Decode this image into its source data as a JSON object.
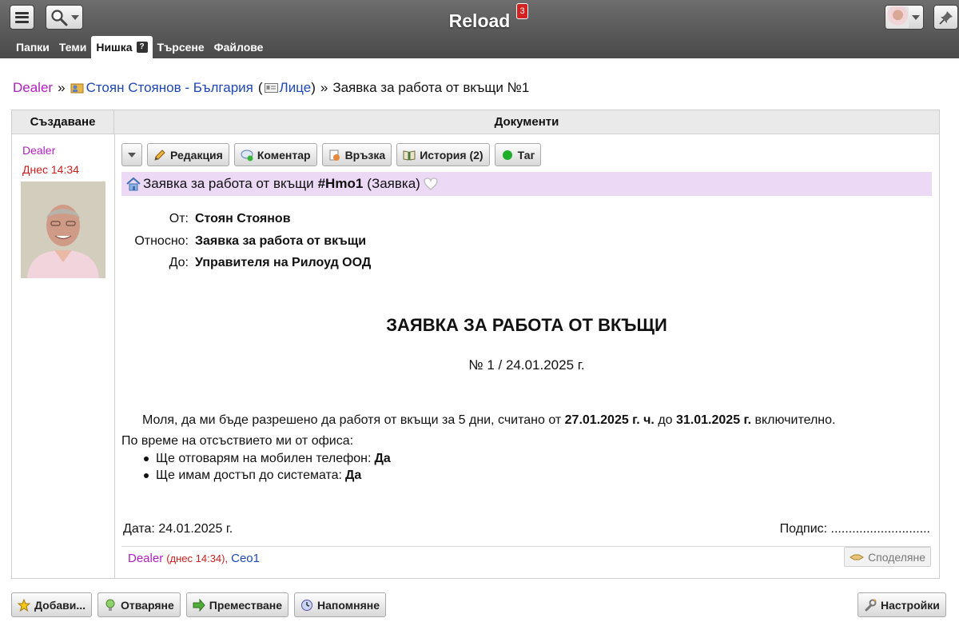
{
  "app": {
    "title": "Reload",
    "notifications": "3"
  },
  "tabs": [
    {
      "label": "Папки"
    },
    {
      "label": "Теми"
    },
    {
      "label": "Нишка",
      "help": "?"
    },
    {
      "label": "Търсене"
    },
    {
      "label": "Файлове"
    }
  ],
  "breadcrumb": {
    "root": "Dealer",
    "sep": "»",
    "contact": "Стоян Стоянов - България",
    "paren_open": "(",
    "type": "Лице",
    "paren_close": ")",
    "sep2": "»",
    "current": "Заявка за работа от вкъщи №1"
  },
  "columns": {
    "left": "Създаване",
    "right": "Документи"
  },
  "creator": {
    "name": "Dealer",
    "time": "Днес 14:34"
  },
  "toolbar": {
    "edit": "Редакция",
    "comment": "Коментар",
    "link": "Връзка",
    "history": "История (2)",
    "tag": "Таг"
  },
  "document": {
    "title_prefix": "Заявка за работа от вкъщи",
    "code": "#Hmo1",
    "kind": "(Заявка)",
    "from_label": "От:",
    "from": "Стоян Стоянов",
    "subject_label": "Относно:",
    "subject": "Заявка за работа от вкъщи",
    "to_label": "До:",
    "to": "Управителя на Рилоуд ООД",
    "heading": "ЗАЯВКА ЗА РАБОТА ОТ ВКЪЩИ",
    "number": "№ 1 / 24.01.2025 г.",
    "body_start": "Моля, да ми бъде разрешено да работя от вкъщи за 5 дни, считано от",
    "date_from": "27.01.2025 г. ч.",
    "body_mid": "до",
    "date_to": "31.01.2025 г.",
    "body_end": "включително.",
    "absence_intro": "По време на отсъствието ми от офиса:",
    "bullet1_text": "Ще отговарям на мобилен телефон:",
    "bullet1_val": "Да",
    "bullet2_text": "Ще имам достъп до системата:",
    "bullet2_val": "Да",
    "date_line": "Дата: 24.01.2025 г.",
    "signature_line": "Подпис: ............................"
  },
  "footer_meta": {
    "author": "Dealer",
    "time": "(днес 14:34),",
    "recipient": "Ceo1",
    "share": "Споделяне"
  },
  "bottom": {
    "add": "Добави...",
    "open": "Отваряне",
    "move": "Преместване",
    "remind": "Напомняне",
    "settings": "Настройки"
  },
  "colors": {
    "accent_purple": "#b11fbf",
    "link_blue": "#1e47b5",
    "time_red": "#c81e1e",
    "title_bar": "#ecd9f6"
  }
}
